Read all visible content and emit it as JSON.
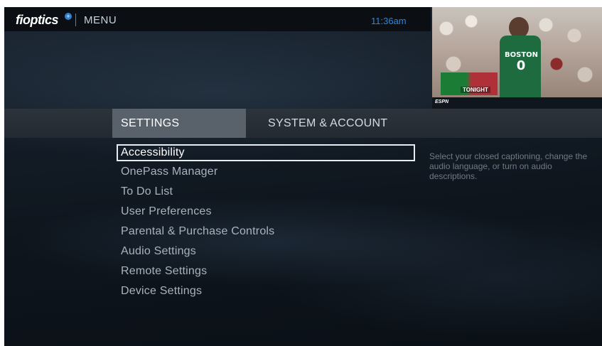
{
  "header": {
    "logo": "fioptics",
    "logo_plus": "+",
    "menu_label": "MENU",
    "clock": "11:36am"
  },
  "preview": {
    "jersey_team": "BOSTON",
    "jersey_number": "0",
    "promo_text": "TONIGHT",
    "network": "ESPN"
  },
  "tabs": [
    {
      "label": "SETTINGS",
      "selected": true
    },
    {
      "label": "SYSTEM & ACCOUNT",
      "selected": false
    }
  ],
  "menu": {
    "items": [
      {
        "label": "Accessibility",
        "selected": true
      },
      {
        "label": "OnePass Manager",
        "selected": false
      },
      {
        "label": "To Do List",
        "selected": false
      },
      {
        "label": "User Preferences",
        "selected": false
      },
      {
        "label": "Parental & Purchase Controls",
        "selected": false
      },
      {
        "label": "Audio Settings",
        "selected": false
      },
      {
        "label": "Remote Settings",
        "selected": false
      },
      {
        "label": "Device Settings",
        "selected": false
      }
    ],
    "description": "Select your closed captioning, change the audio language, or turn on audio descriptions."
  },
  "colors": {
    "accent_blue": "#2e86d6",
    "selected_tab_bg": "#59626b",
    "selection_border": "#e7ecf1"
  }
}
